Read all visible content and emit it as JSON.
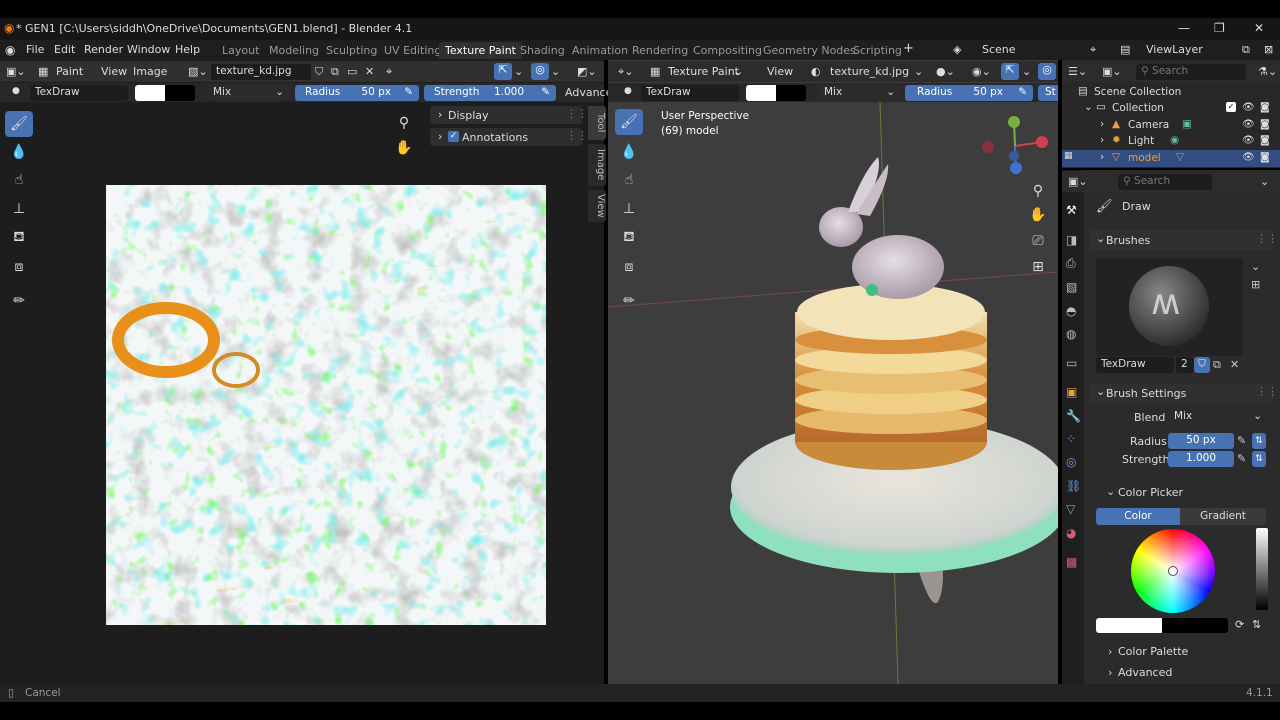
{
  "titlebar": {
    "title": "* GEN1 [C:\\Users\\siddh\\OneDrive\\Documents\\GEN1.blend] - Blender 4.1"
  },
  "menu": [
    "File",
    "Edit",
    "Render",
    "Window",
    "Help"
  ],
  "workspaces": [
    "Layout",
    "Modeling",
    "Sculpting",
    "UV Editing",
    "Texture Paint",
    "Shading",
    "Animation",
    "Rendering",
    "Compositing",
    "Geometry Nodes",
    "Scripting"
  ],
  "active_workspace": "Texture Paint",
  "scene": {
    "label": "Scene",
    "view_layer": "ViewLayer"
  },
  "image_editor": {
    "mode": "Paint",
    "view": "View",
    "image_menu": "Image",
    "image_name": "texture_kd.jpg",
    "brush": "TexDraw",
    "blend": "Mix",
    "radius_label": "Radius",
    "radius_value": "50 px",
    "strength_label": "Strength",
    "strength_value": "1.000",
    "advanced": "Advanced",
    "display": "Display",
    "annotations": "Annotations",
    "tabs": [
      "Tool",
      "Image",
      "View"
    ]
  },
  "viewport": {
    "mode": "Texture Paint",
    "view": "View",
    "image_name": "texture_kd.jpg",
    "brush": "TexDraw",
    "blend": "Mix",
    "radius_label": "Radius",
    "radius_value": "50 px",
    "strength_short": "St",
    "perspective": "User Perspective",
    "object": "(69) model"
  },
  "outliner": {
    "search_placeholder": "Search",
    "root": "Scene Collection",
    "items": [
      "Collection",
      "Camera",
      "Light",
      "model"
    ]
  },
  "properties": {
    "search_placeholder": "Search",
    "tool": "Draw",
    "brushes": "Brushes",
    "brush_name": "TexDraw",
    "brush_users": "2",
    "brush_settings": "Brush Settings",
    "blend_label": "Blend",
    "blend_value": "Mix",
    "radius_label": "Radius",
    "radius_value": "50 px",
    "strength_label": "Strength",
    "strength_value": "1.000",
    "color_picker": "Color Picker",
    "color_tab": "Color",
    "gradient_tab": "Gradient",
    "color_palette": "Color Palette",
    "advanced": "Advanced"
  },
  "status": {
    "left": "Cancel",
    "version": "4.1.1"
  },
  "colors": {
    "accent": "#4772b3",
    "active_row": "#334d80",
    "bg": "#1d1d1d",
    "header": "#303030"
  }
}
